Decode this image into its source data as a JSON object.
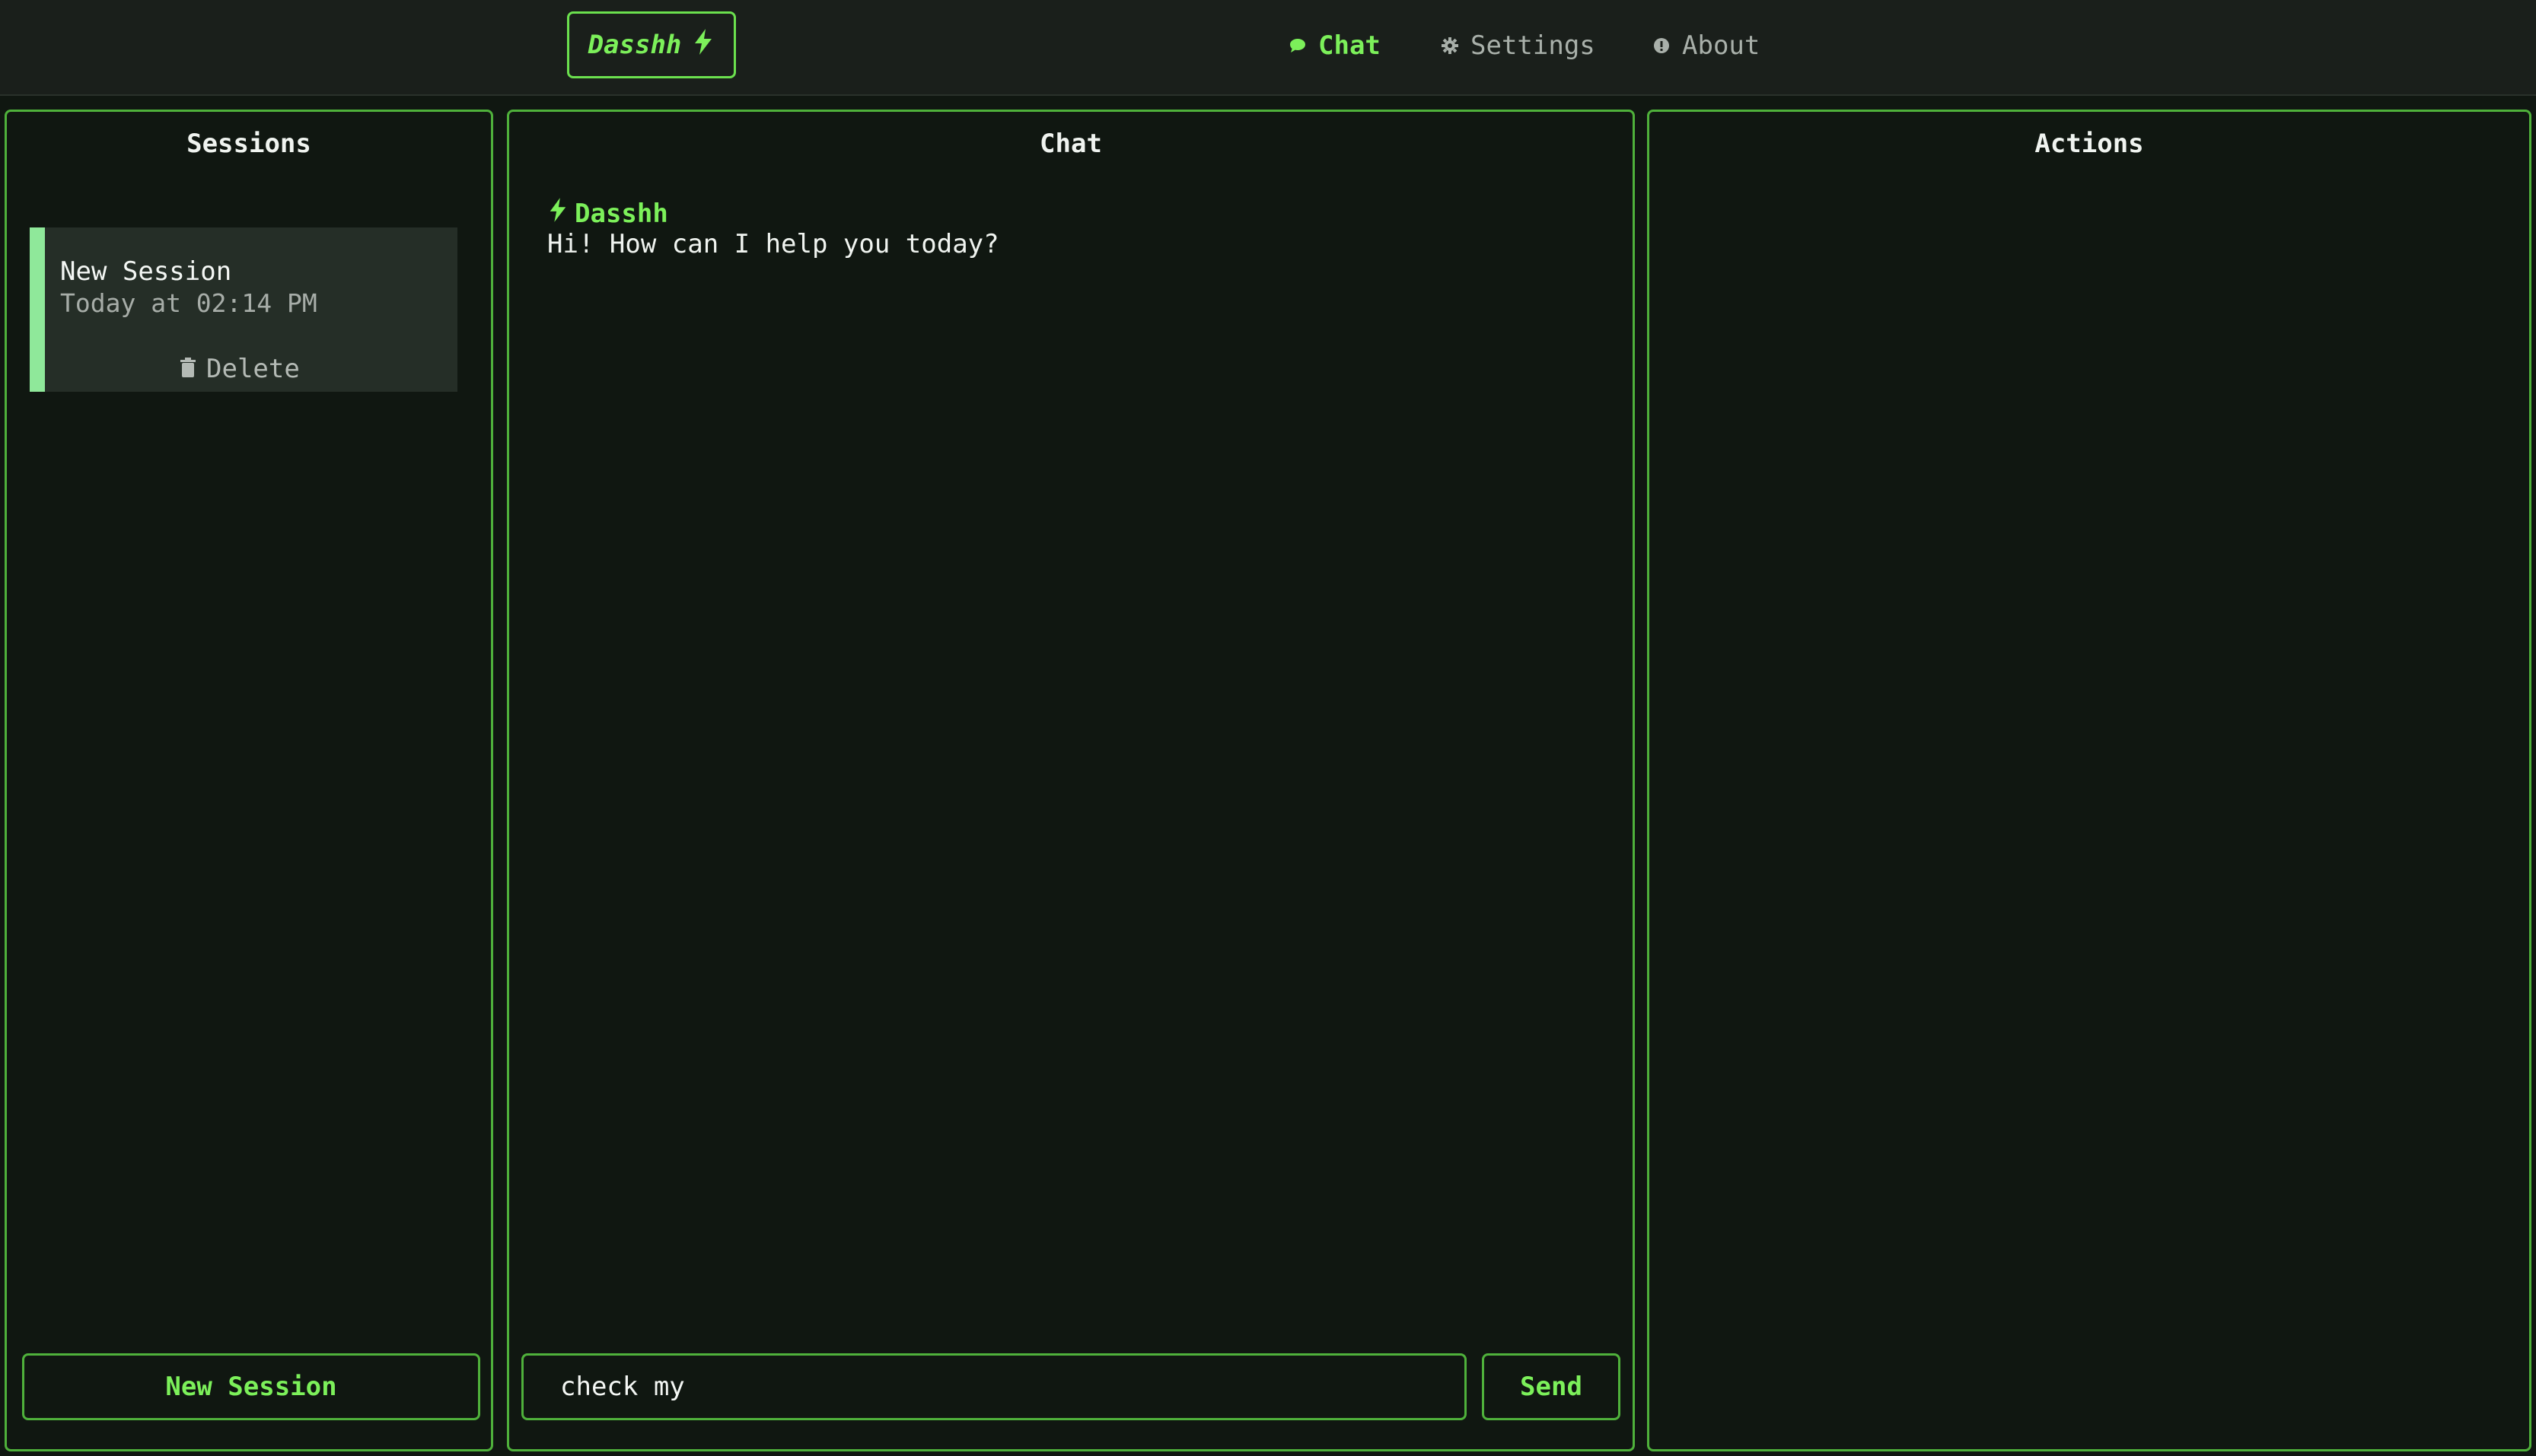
{
  "header": {
    "logo_text": "Dasshh",
    "nav": [
      {
        "label": "Chat",
        "icon": "chat-bubble-icon",
        "active": true
      },
      {
        "label": "Settings",
        "icon": "gear-icon",
        "active": false
      },
      {
        "label": "About",
        "icon": "info-icon",
        "active": false
      }
    ]
  },
  "sessions_panel": {
    "title": "Sessions",
    "sessions": [
      {
        "title": "New Session",
        "time": "Today at 02:14 PM",
        "delete_label": "Delete"
      }
    ],
    "new_session_label": "New Session"
  },
  "chat_panel": {
    "title": "Chat",
    "messages": [
      {
        "author": "Dasshh",
        "text": "Hi! How can I help you today?"
      }
    ],
    "input_value": "check my",
    "send_label": "Send"
  },
  "actions_panel": {
    "title": "Actions"
  },
  "colors": {
    "accent": "#7cf05a",
    "border": "#4fb13b",
    "background": "#101711",
    "topbar": "#1a1f1b",
    "session_card": "#252e27",
    "session_marker": "#8fe89a"
  }
}
